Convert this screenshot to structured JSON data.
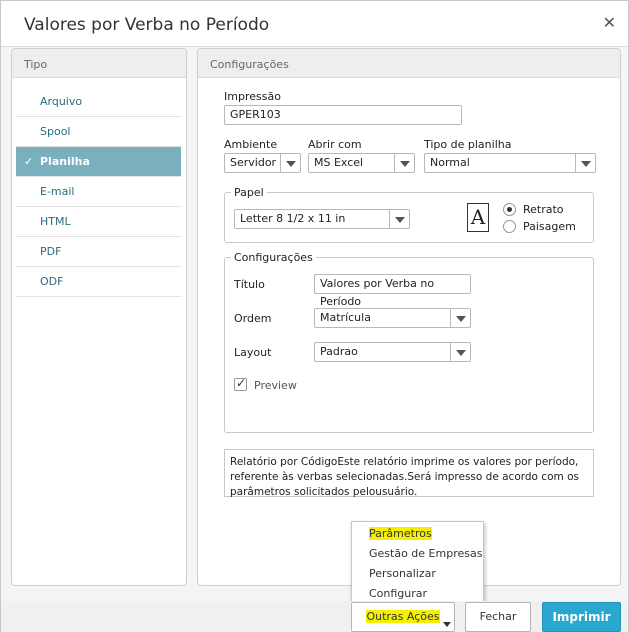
{
  "dialog": {
    "title": "Valores por Verba no Período"
  },
  "tipo": {
    "header": "Tipo",
    "items": [
      {
        "label": "Arquivo"
      },
      {
        "label": "Spool"
      },
      {
        "label": "Planilha"
      },
      {
        "label": "E-mail"
      },
      {
        "label": "HTML"
      },
      {
        "label": "PDF"
      },
      {
        "label": "ODF"
      }
    ],
    "selected": "Planilha"
  },
  "config": {
    "header": "Configurações",
    "impressao_label": "Impressão",
    "impressao_value": "GPER103",
    "ambiente_label": "Ambiente",
    "ambiente_value": "Servidor",
    "abrir_label": "Abrir com",
    "abrir_value": "MS Excel",
    "tipo_planilha_label": "Tipo de planilha",
    "tipo_planilha_value": "Normal",
    "papel": {
      "title": "Papel",
      "size_value": "Letter 8 1/2 x 11 in",
      "page_icon_letter": "A",
      "retrato_label": "Retrato",
      "paisagem_label": "Paisagem",
      "orientation": "Retrato"
    },
    "sub": {
      "title": "Configurações",
      "titulo_label": "Título",
      "titulo_value": "Valores por Verba no Período",
      "ordem_label": "Ordem",
      "ordem_value": "Matrícula",
      "layout_label": "Layout",
      "layout_value": "Padrao",
      "preview_label": "Preview",
      "preview_checked": true
    },
    "description": "Relatório por CódigoEste relatório imprime os valores por período, referente às verbas selecionadas.Será impresso de acordo com os parâmetros solicitados pelousuário."
  },
  "menu": {
    "items": [
      {
        "label": "Parâmetros"
      },
      {
        "label": "Gestão de Empresas"
      },
      {
        "label": "Personalizar"
      },
      {
        "label": "Configurar"
      }
    ]
  },
  "footer": {
    "outras_label": "Outras Ações",
    "fechar_label": "Fechar",
    "imprimir_label": "Imprimir"
  }
}
